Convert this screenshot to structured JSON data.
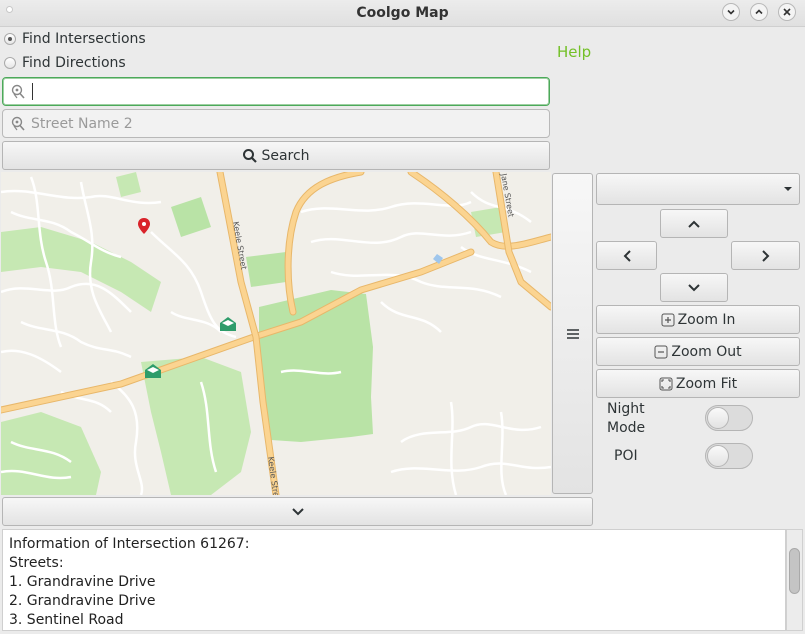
{
  "window": {
    "title": "Coolgo Map"
  },
  "mode": {
    "options": [
      "Find Intersections",
      "Find Directions"
    ],
    "selected": "Find Intersections"
  },
  "help_label": "Help",
  "search": {
    "street1_value": "",
    "street2_placeholder": "Street Name 2",
    "search_label": "Search"
  },
  "map": {
    "street_labels": [
      "Keele Street",
      "Keele Street",
      "Jane Street"
    ],
    "marker_color": "#d9232a",
    "park_color": "#b9e3a6",
    "road_color": "#fbd491"
  },
  "controls": {
    "layer_select_value": "",
    "zoom_in_label": "Zoom In",
    "zoom_out_label": "Zoom Out",
    "zoom_fit_label": "Zoom Fit",
    "night_mode_label": "Night Mode",
    "poi_label": "POI",
    "night_mode_on": false,
    "poi_on": false
  },
  "info": {
    "lines": [
      "Information of Intersection 61267:",
      "Streets:",
      "1. Grandravine Drive",
      "2. Grandravine Drive",
      "3. Sentinel Road"
    ]
  }
}
